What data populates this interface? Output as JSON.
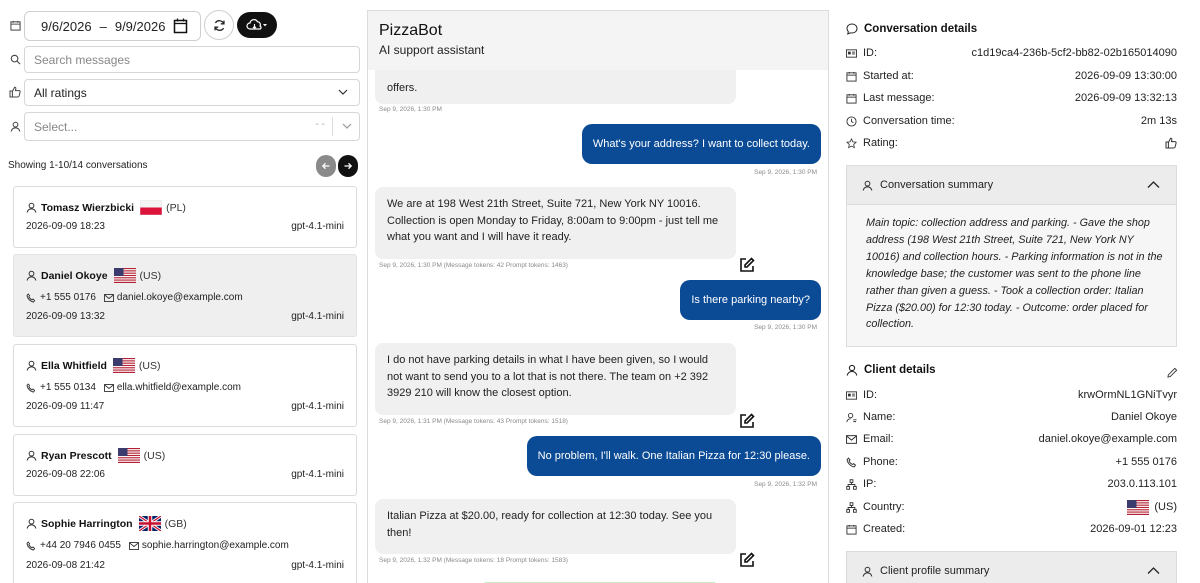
{
  "filters": {
    "date_from": "9/6/2026",
    "date_sep": "–",
    "date_to": "9/9/2026",
    "search_placeholder": "Search messages",
    "rating_value": "All ratings",
    "user_placeholder": "Select...",
    "user_clear": "- -"
  },
  "list": {
    "count_text": "Showing 1-10/14 conversations",
    "conversations": [
      {
        "name": "Tomasz Wierzbicki",
        "country": "(PL)",
        "flag": "pl",
        "phone": "",
        "email": "",
        "date": "2026-09-09 18:23",
        "model": "gpt-4.1-mini"
      },
      {
        "name": "Daniel Okoye",
        "country": "(US)",
        "flag": "us",
        "phone": "+1 555 0176",
        "email": "daniel.okoye@example.com",
        "date": "2026-09-09 13:32",
        "model": "gpt-4.1-mini"
      },
      {
        "name": "Ella Whitfield",
        "country": "(US)",
        "flag": "us",
        "phone": "+1 555 0134",
        "email": "ella.whitfield@example.com",
        "date": "2026-09-09 11:47",
        "model": "gpt-4.1-mini"
      },
      {
        "name": "Ryan Prescott",
        "country": "(US)",
        "flag": "us",
        "phone": "",
        "email": "",
        "date": "2026-09-08 22:06",
        "model": "gpt-4.1-mini"
      },
      {
        "name": "Sophie Harrington",
        "country": "(GB)",
        "flag": "gb",
        "phone": "+44 20 7946 0455",
        "email": "sophie.harrington@example.com",
        "date": "2026-09-08 21:42",
        "model": "gpt-4.1-mini"
      }
    ]
  },
  "chat": {
    "bot_name": "PizzaBot",
    "bot_subtitle": "AI support assistant",
    "messages": [
      {
        "role": "bot",
        "text": "offers.",
        "meta": "Sep 9, 2026, 1:30 PM"
      },
      {
        "role": "user",
        "text": "What's your address? I want to collect today.",
        "meta": "Sep 9, 2026, 1:30 PM"
      },
      {
        "role": "bot",
        "text": "We are at 198 West 21th Street, Suite 721, New York NY 10016. Collection is open Monday to Friday, 8:00am to 9:00pm - just tell me what you want and I will have it ready.",
        "meta": "Sep 9, 2026, 1:30 PM     (Message tokens: 42 Prompt tokens: 1463)"
      },
      {
        "role": "user",
        "text": "Is there parking nearby?",
        "meta": "Sep 9, 2026, 1:30 PM"
      },
      {
        "role": "bot",
        "text": "I do not have parking details in what I have been given, so I would not want to send you to a lot that is not there. The team on +2 392 3929 210 will know the closest option.",
        "meta": "Sep 9, 2026, 1:31 PM     (Message tokens: 43 Prompt tokens: 1518)"
      },
      {
        "role": "user",
        "text": "No problem, I'll walk. One Italian Pizza for 12:30 please.",
        "meta": "Sep 9, 2026, 1:32 PM"
      },
      {
        "role": "bot",
        "text": "Italian Pizza at $20.00, ready for collection at 12:30 today. See you then!",
        "meta": "Sep 9, 2026, 1:32 PM     (Message tokens: 18 Prompt tokens: 1583)"
      }
    ]
  },
  "details": {
    "title": "Conversation details",
    "id_label": "ID:",
    "id_value": "c1d19ca4-236b-5cf2-bb82-02b165014090",
    "started_label": "Started at:",
    "started_value": "2026-09-09 13:30:00",
    "last_label": "Last message:",
    "last_value": "2026-09-09 13:32:13",
    "time_label": "Conversation time:",
    "time_value": "2m 13s",
    "rating_label": "Rating:",
    "summary_title": "Conversation summary",
    "summary_text": "Main topic: collection address and parking. - Gave the shop address (198 West 21th Street, Suite 721, New York NY 10016) and collection hours. - Parking information is not in the knowledge base; the customer was sent to the phone line rather than given a guess. - Took a collection order: Italian Pizza ($20.00) for 12:30 today. - Outcome: order placed for collection."
  },
  "client": {
    "title": "Client details",
    "id_label": "ID:",
    "id_value": "krwOrmNL1GNiTvyr",
    "name_label": "Name:",
    "name_value": "Daniel Okoye",
    "email_label": "Email:",
    "email_value": "daniel.okoye@example.com",
    "phone_label": "Phone:",
    "phone_value": "+1 555 0176",
    "ip_label": "IP:",
    "ip_value": "203.0.113.101",
    "country_label": "Country:",
    "country_value": "(US)",
    "created_label": "Created:",
    "created_value": "2026-09-01 12:23",
    "profile_summary_title": "Client profile summary"
  },
  "colors": {
    "user_bubble": "#0b4b96",
    "bot_bubble": "#f0f0f0",
    "selected_card": "#efefef",
    "dark_button": "#111111"
  }
}
